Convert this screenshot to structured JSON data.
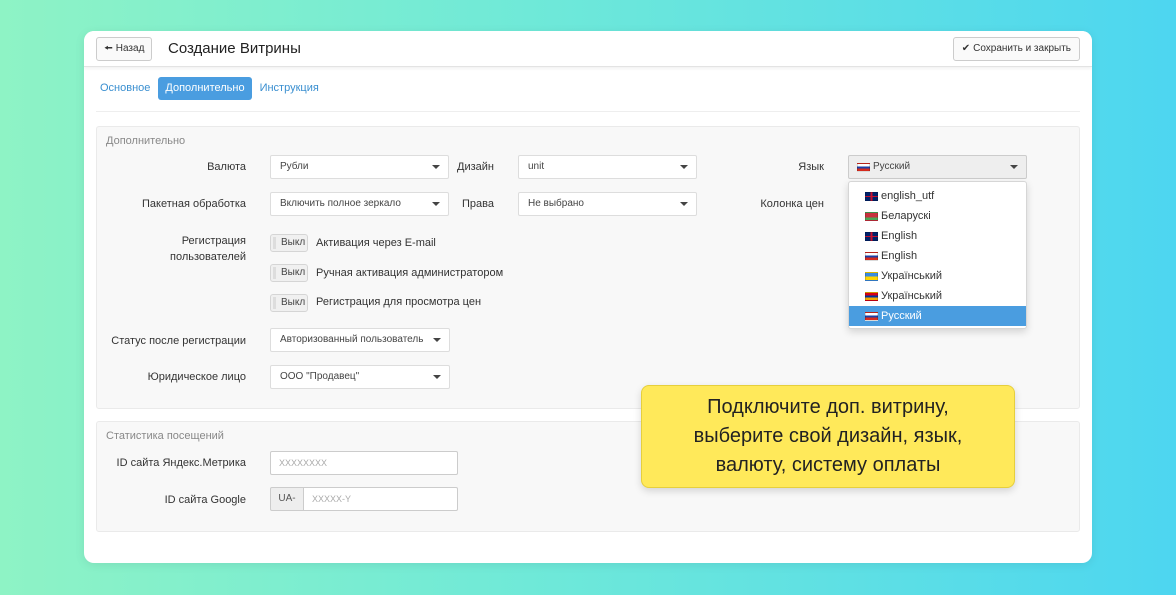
{
  "header": {
    "back_label": "Назад",
    "title": "Создание Витрины",
    "save_label": "Сохранить и закрыть"
  },
  "tabs": [
    {
      "label": "Основное",
      "active": false
    },
    {
      "label": "Дополнительно",
      "active": true
    },
    {
      "label": "Инструкция",
      "active": false
    }
  ],
  "additional": {
    "title": "Дополнительно",
    "currency": {
      "label": "Валюта",
      "value": "Рубли"
    },
    "design": {
      "label": "Дизайн",
      "value": "unit"
    },
    "language": {
      "label": "Язык",
      "value": "Русский"
    },
    "batch": {
      "label": "Пакетная обработка",
      "value": "Включить полное зеркало"
    },
    "rights": {
      "label": "Права",
      "value": "Не выбрано"
    },
    "price_column": {
      "label": "Колонка цен"
    },
    "registration": {
      "label": "Регистрация пользователей",
      "toggles": [
        {
          "state": "Выкл",
          "label": "Активация через E-mail"
        },
        {
          "state": "Выкл",
          "label": "Ручная активация администратором"
        },
        {
          "state": "Выкл",
          "label": "Регистрация для просмотра цен"
        }
      ]
    },
    "status_after": {
      "label": "Статус после регистрации",
      "value": "Авторизованный пользователь"
    },
    "legal_entity": {
      "label": "Юридическое лицо",
      "value": "ООО \"Продавец\""
    }
  },
  "language_dropdown": {
    "options": [
      {
        "label": "english_utf",
        "flag": "gb"
      },
      {
        "label": "Беларускі",
        "flag": "by"
      },
      {
        "label": "English",
        "flag": "gb"
      },
      {
        "label": "English",
        "flag": "ru"
      },
      {
        "label": "Український",
        "flag": "ua"
      },
      {
        "label": "Український",
        "flag": "am"
      },
      {
        "label": "Русский",
        "flag": "ru",
        "selected": true
      }
    ]
  },
  "stats": {
    "title": "Статистика посещений",
    "yandex": {
      "label": "ID сайта Яндекс.Метрика",
      "placeholder": "XXXXXXXX"
    },
    "google": {
      "label": "ID сайта Google",
      "prefix": "UA-",
      "placeholder": "XXXXX-Y"
    }
  },
  "callout": {
    "text": "Подключите доп. витрину,\nвыберите свой дизайн, язык,\nвалюту, систему оплаты"
  },
  "colors": {
    "accent": "#4a9de0",
    "callout_bg": "#ffe95a"
  }
}
